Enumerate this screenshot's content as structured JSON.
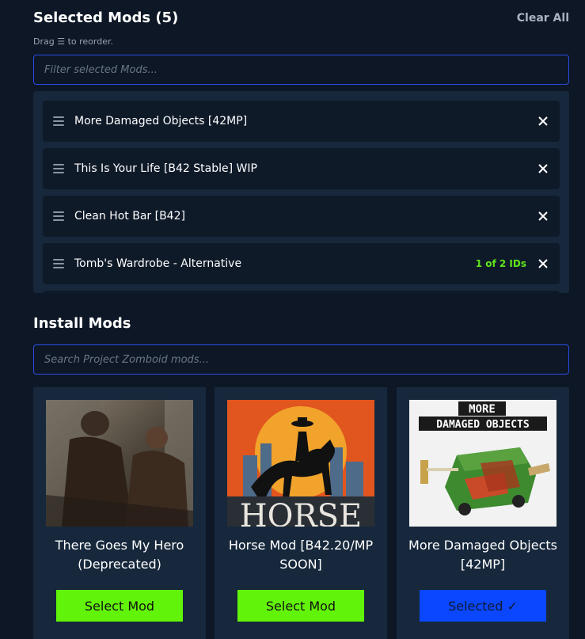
{
  "selected": {
    "title": "Selected Mods (5)",
    "clear_all": "Clear All",
    "drag_hint": "Drag ☰ to reorder.",
    "filter_placeholder": "Filter selected Mods...",
    "items": [
      {
        "name": "More Damaged Objects [42MP]",
        "badge": ""
      },
      {
        "name": "This Is Your Life [B42 Stable] WIP",
        "badge": ""
      },
      {
        "name": "Clean Hot Bar [B42]",
        "badge": ""
      },
      {
        "name": "Tomb's Wardrobe - Alternative",
        "badge": "1 of 2 IDs"
      }
    ]
  },
  "install": {
    "title": "Install Mods",
    "search_placeholder": "Search Project Zomboid mods...",
    "cards": [
      {
        "title": "There Goes My Hero (Deprecated)",
        "button": "Select Mod",
        "state": "unselected"
      },
      {
        "title": "Horse Mod [B42.20/MP SOON]",
        "button": "Select Mod",
        "state": "unselected"
      },
      {
        "title": "More Damaged Objects [42MP]",
        "button": "Selected ✓",
        "state": "selected",
        "thumb_text": [
          "MORE",
          "DAMAGED OBJECTS"
        ]
      }
    ],
    "horse_thumb_text": "HORSE"
  },
  "colors": {
    "background": "#0d1726",
    "panel": "#17283c",
    "accent_border": "#2b4de6",
    "select_green": "#62f30a",
    "selected_blue": "#0a47ff",
    "badge_green": "#5fe51b"
  }
}
